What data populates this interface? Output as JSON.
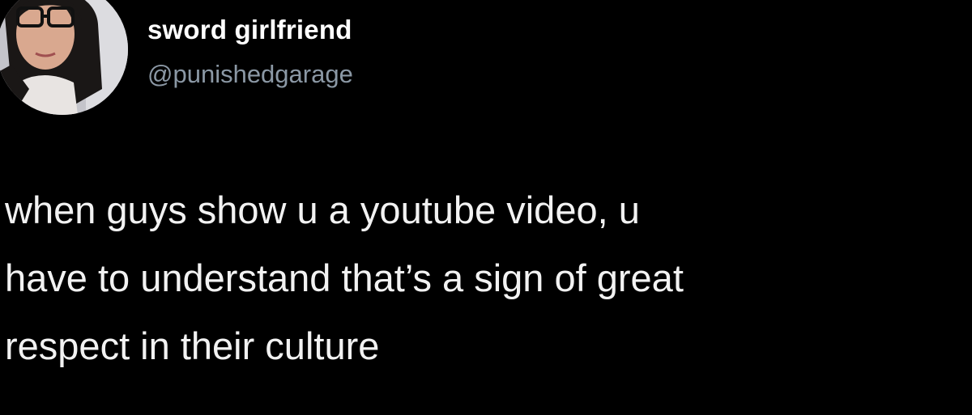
{
  "author": {
    "display_name": "sword girlfriend",
    "handle": "@punishedgarage",
    "avatar_icon": "profile-photo"
  },
  "tweet": {
    "lines": [
      "when guys show u a youtube video, u",
      "have to understand that’s a sign of great",
      "respect in their culture"
    ]
  },
  "colors": {
    "background": "#000000",
    "text": "#ffffff",
    "handle": "#8b98a5"
  }
}
